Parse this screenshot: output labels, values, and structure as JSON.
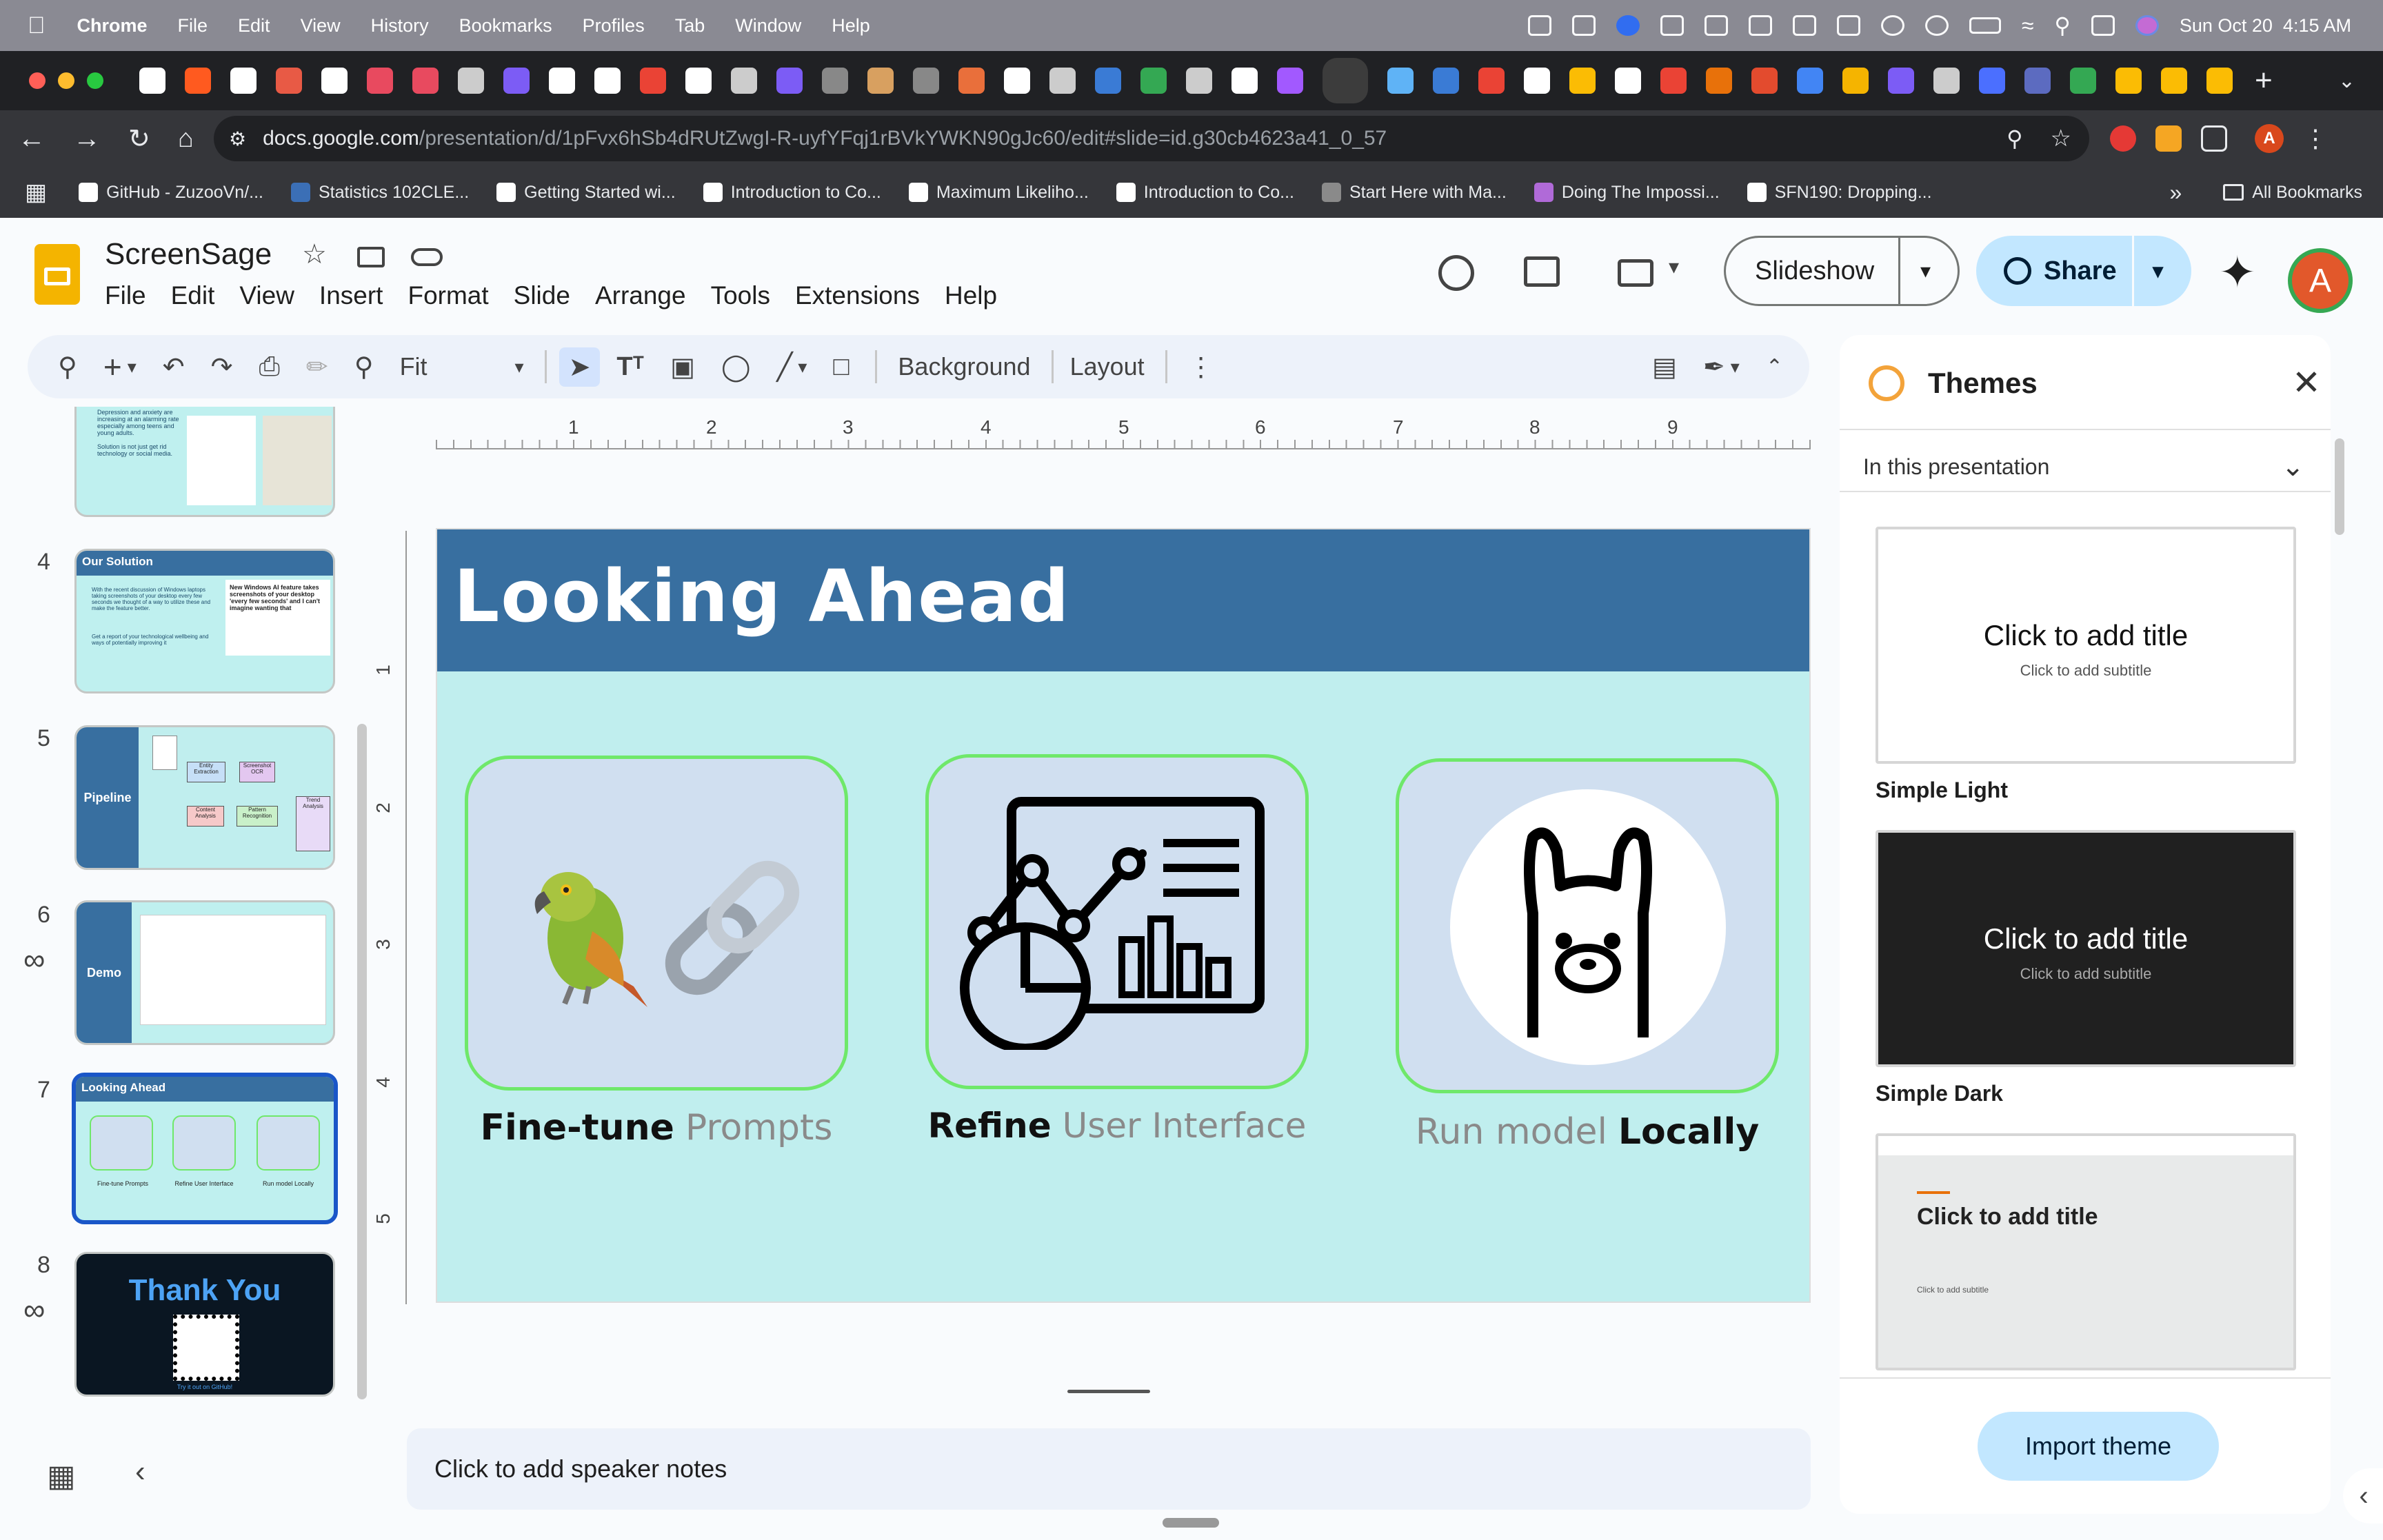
{
  "mac_menubar": {
    "app": "Chrome",
    "menus": [
      "File",
      "Edit",
      "View",
      "History",
      "Bookmarks",
      "Profiles",
      "Tab",
      "Window",
      "Help"
    ],
    "datetime": "Sun Oct 20  4:15 AM"
  },
  "browser": {
    "url_host": "docs.google.com",
    "url_path": "/presentation/d/1pFvx6hSb4dRUtZwgI-R-uyfYFqj1rBVkYWKN90gJc60/edit#slide=id.g30cb4623a41_0_57",
    "profile_initial": "A",
    "bookmarks": [
      {
        "label": "GitHub - ZuzooVn/...",
        "color": "#ffffff"
      },
      {
        "label": "Statistics 102CLE...",
        "color": "#3b6fb6"
      },
      {
        "label": "Getting Started wi...",
        "color": "#ffffff"
      },
      {
        "label": "Introduction to Co...",
        "color": "#ffffff"
      },
      {
        "label": "Maximum Likeliho...",
        "color": "#ffffff"
      },
      {
        "label": "Introduction to Co...",
        "color": "#ffffff"
      },
      {
        "label": "Start Here with Ma...",
        "color": "#8a8a8a"
      },
      {
        "label": "Doing The Impossi...",
        "color": "#b06ad8"
      },
      {
        "label": "SFN190: Dropping...",
        "color": "#ffffff"
      }
    ],
    "all_bookmarks": "All Bookmarks",
    "tab_favicons": [
      "#fff",
      "#ff5a1f",
      "#fff",
      "#e85a45",
      "#fff",
      "#e84a5f",
      "#e84a5f",
      "#ccc",
      "#7c5cf5",
      "#fff",
      "#fff",
      "#ea4335",
      "#fff",
      "#ccc",
      "#7c5cf5",
      "#888",
      "#d8a060",
      "#888",
      "#e96f3b",
      "#fff",
      "#ccc",
      "#3a7bd5",
      "#34a853",
      "#ccc",
      "#fff",
      "#a259ff",
      "#fff",
      "#5fb3f6",
      "#3a7bd5",
      "#ea4335",
      "#fff",
      "#fbbc04",
      "#fff",
      "#ea4335",
      "#e8710a",
      "#e34b2e",
      "#4285f4",
      "#f5b400",
      "#7c5cf5",
      "#ccc",
      "#4b6fff",
      "#5c6bc0",
      "#34a853",
      "#fbbc04",
      "#fbbc04",
      "#fbbc04"
    ]
  },
  "docs": {
    "title": "ScreenSage",
    "menus": [
      "File",
      "Edit",
      "View",
      "Insert",
      "Format",
      "Slide",
      "Arrange",
      "Tools",
      "Extensions",
      "Help"
    ],
    "slideshow": "Slideshow",
    "share": "Share",
    "avatar": "A",
    "toolbar": {
      "zoom": "Fit",
      "background": "Background",
      "layout": "Layout"
    },
    "ruler_h": [
      "1",
      "2",
      "3",
      "4",
      "5",
      "6",
      "7",
      "8",
      "9"
    ],
    "ruler_v": [
      "1",
      "2",
      "3",
      "4",
      "5"
    ]
  },
  "filmstrip": [
    {
      "num": "",
      "title": "",
      "lines": [
        "Depression and anxiety are increasing at an alarming rate especially among teens and young adults.",
        "Solution is not just get rid technology or social media."
      ]
    },
    {
      "num": "4",
      "title": "Our Solution",
      "lines": [
        "With the recent discussion of Windows laptops taking screenshots of your desktop every few seconds we thought of a way to utilize these and make the feature better.",
        "Get a report of your technological wellbeing and ways of potentially improving it"
      ],
      "quote": "New Windows AI feature takes screenshots of your desktop 'every few seconds' and I can't imagine wanting that"
    },
    {
      "num": "5",
      "title": "Pipeline",
      "nodes": [
        "Entity Extraction",
        "Screenshot OCR",
        "Content Analysis",
        "Pattern Recognition",
        "Trend Analysis"
      ]
    },
    {
      "num": "6",
      "title": "Demo"
    },
    {
      "num": "7",
      "title": "Looking Ahead",
      "caps": [
        "Fine-tune Prompts",
        "Refine User Interface",
        "Run model Locally"
      ]
    },
    {
      "num": "8",
      "title": "Thank You",
      "sub": "Try it out on GitHub!"
    }
  ],
  "slide": {
    "title": "Looking Ahead",
    "cards": [
      {
        "bold": "Fine-tune",
        "light": "Prompts",
        "icon_names": [
          "parrot-icon",
          "chain-link-icon"
        ]
      },
      {
        "bold": "Refine",
        "light": "User Interface",
        "icon_names": [
          "dashboard-analytics-icon"
        ]
      },
      {
        "light": "Run model",
        "bold": "Locally",
        "icon_names": [
          "llama-icon"
        ]
      }
    ],
    "colors": {
      "header": "#386fa0",
      "background": "#c0eeee",
      "card": "#d0dff0",
      "card_border": "#6fe86a"
    }
  },
  "speaker_notes_placeholder": "Click to add speaker notes",
  "themes_panel": {
    "title": "Themes",
    "section": "In this presentation",
    "themes": [
      {
        "name": "Simple Light",
        "title": "Click to add title",
        "subtitle": "Click to add subtitle"
      },
      {
        "name": "Simple Dark",
        "title": "Click to add title",
        "subtitle": "Click to add subtitle"
      },
      {
        "name": "",
        "title": "Click to add title",
        "subtitle": "Click to add subtitle"
      }
    ],
    "import": "Import theme"
  }
}
